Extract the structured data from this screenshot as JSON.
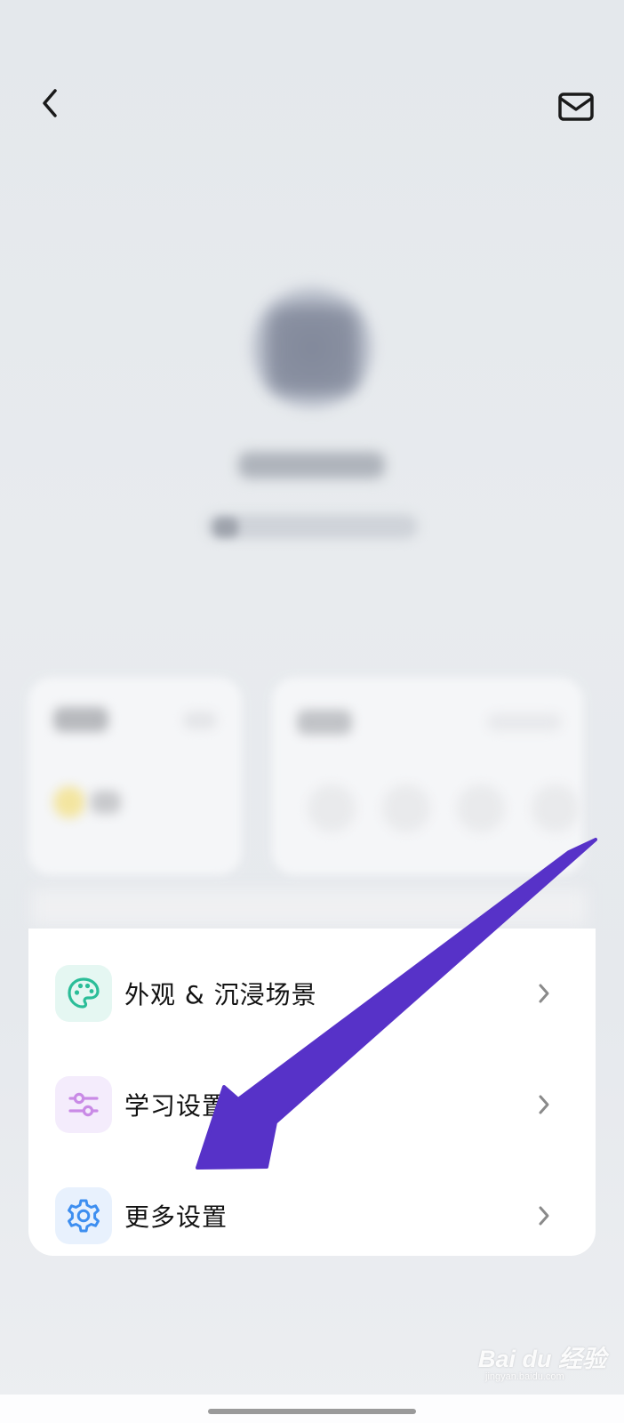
{
  "header": {
    "back_icon": "chevron-left-icon",
    "mail_icon": "envelope-icon"
  },
  "menu": {
    "items": [
      {
        "label": "外观 & 沉浸场景",
        "icon": "palette-icon",
        "icon_color": "#2bbd98"
      },
      {
        "label": "学习设置",
        "icon": "sliders-icon",
        "icon_color": "#c98ae6"
      },
      {
        "label": "更多设置",
        "icon": "gear-icon",
        "icon_color": "#3d8ef0"
      }
    ]
  },
  "annotation": {
    "arrow_color": "#5732c8"
  },
  "watermark": {
    "text": "Bai du 经验",
    "subtext": "jingyan.baidu.com"
  }
}
